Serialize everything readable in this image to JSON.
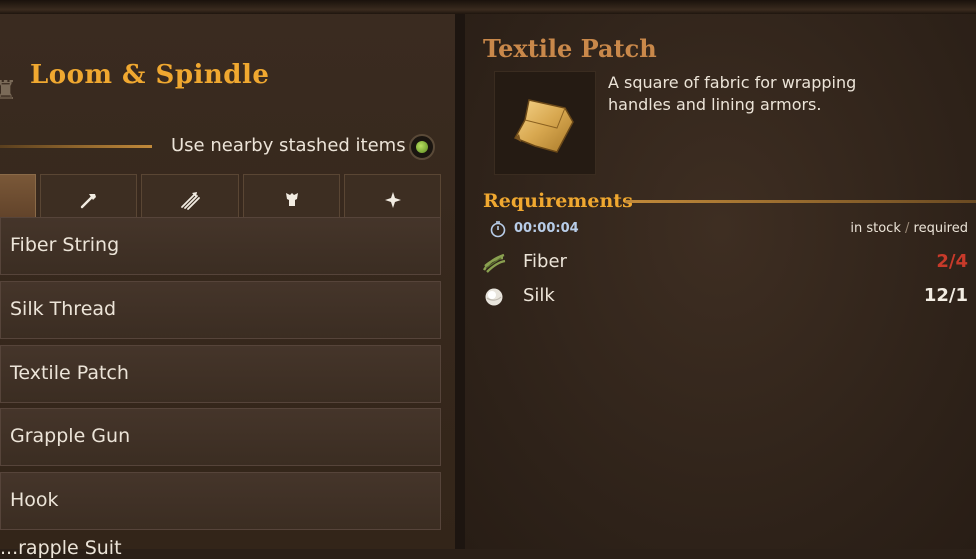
{
  "station": {
    "title": "Loom & Spindle",
    "stash_label": "Use nearby stashed items",
    "stash_enabled": true
  },
  "category_tabs": [
    {
      "icon": "all-items-icon",
      "active": true,
      "glyph": ""
    },
    {
      "icon": "hammer-icon",
      "active": false,
      "glyph": "🔨"
    },
    {
      "icon": "arrows-icon",
      "active": false,
      "glyph": "⫽"
    },
    {
      "icon": "armor-icon",
      "active": false,
      "glyph": "♜"
    },
    {
      "icon": "sparkle-icon",
      "active": false,
      "glyph": "✦"
    }
  ],
  "recipes": [
    {
      "label": "Fiber String"
    },
    {
      "label": "Silk Thread"
    },
    {
      "label": "Textile Patch"
    },
    {
      "label": "Grapple Gun"
    },
    {
      "label": "Hook"
    }
  ],
  "partial_recipe": "...rapple Suit",
  "detail": {
    "title": "Textile Patch",
    "image_icon": "fabric-patch-icon",
    "description": "A square of fabric for wrapping handles and lining armors."
  },
  "requirements": {
    "title": "Requirements",
    "craft_time": "00:00:04",
    "stock_label": "in stock",
    "required_label": "required",
    "separator": "/",
    "items": [
      {
        "name": "Fiber",
        "icon": "fiber-icon",
        "count": "2/4",
        "status": "short",
        "color": "#c83a2a"
      },
      {
        "name": "Silk",
        "icon": "silk-icon",
        "count": "12/1",
        "status": "ok",
        "color": "#f2ece2"
      }
    ]
  },
  "colors": {
    "accent_gold": "#f0a830",
    "title_copper": "#c9884a",
    "shortage_red": "#c83a2a"
  }
}
